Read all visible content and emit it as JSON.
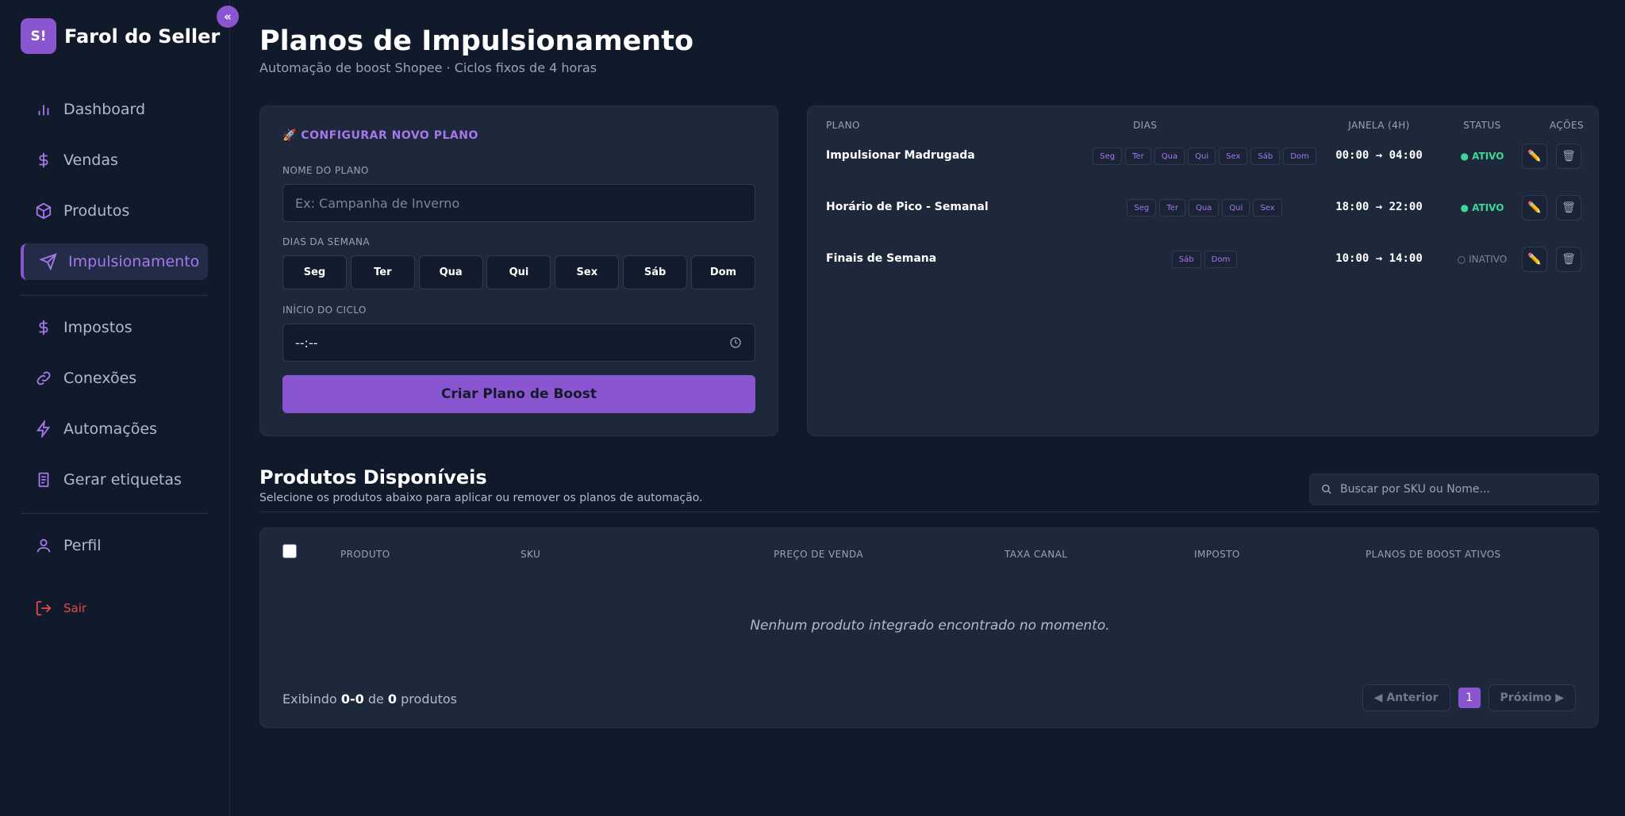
{
  "brand": {
    "logo": "S!",
    "name": "Farol do Seller"
  },
  "collapse_label": "«",
  "nav": {
    "items": [
      {
        "label": "Dashboard",
        "icon": "bar-chart-icon"
      },
      {
        "label": "Vendas",
        "icon": "dollar-icon"
      },
      {
        "label": "Produtos",
        "icon": "box-icon"
      },
      {
        "label": "Impulsionamento",
        "icon": "send-icon"
      },
      {
        "label": "Impostos",
        "icon": "dollar-icon"
      },
      {
        "label": "Conexões",
        "icon": "link-icon"
      },
      {
        "label": "Automações",
        "icon": "bolt-icon"
      },
      {
        "label": "Gerar etiquetas",
        "icon": "document-icon"
      },
      {
        "label": "Perfil",
        "icon": "user-icon"
      }
    ],
    "logout": "Sair"
  },
  "page": {
    "title": "Planos de Impulsionamento",
    "subtitle": "Automação de boost Shopee · Ciclos fixos de 4 horas"
  },
  "form": {
    "title": "🚀 CONFIGURAR NOVO PLANO",
    "name_label": "NOME DO PLANO",
    "name_placeholder": "Ex: Campanha de Inverno",
    "days_label": "DIAS DA SEMANA",
    "days": [
      "Seg",
      "Ter",
      "Qua",
      "Qui",
      "Sex",
      "Sáb",
      "Dom"
    ],
    "cycle_label": "INÍCIO DO CICLO",
    "cycle_value": "--:--",
    "submit": "Criar Plano de Boost"
  },
  "plans": {
    "headers": {
      "plan": "PLANO",
      "days": "DIAS",
      "window": "JANELA (4H)",
      "status": "STATUS",
      "actions": "AÇÕES"
    },
    "rows": [
      {
        "name": "Impulsionar Madrugada",
        "days": [
          "Seg",
          "Ter",
          "Qua",
          "Qui",
          "Sex",
          "Sáb",
          "Dom"
        ],
        "window": "00:00 → 04:00",
        "status": "● ATIVO",
        "active": true
      },
      {
        "name": "Horário de Pico - Semanal",
        "days": [
          "Seg",
          "Ter",
          "Qua",
          "Qui",
          "Sex"
        ],
        "window": "18:00 → 22:00",
        "status": "● ATIVO",
        "active": true
      },
      {
        "name": "Finais de Semana",
        "days": [
          "Sáb",
          "Dom"
        ],
        "window": "10:00 → 14:00",
        "status": "○ INATIVO",
        "active": false
      }
    ],
    "edit_icon": "✏️",
    "delete_icon": "🗑"
  },
  "products": {
    "title": "Produtos Disponíveis",
    "subtitle": "Selecione os produtos abaixo para aplicar ou remover os planos de automação.",
    "search_placeholder": "Buscar por SKU ou Nome...",
    "headers": [
      "PRODUTO",
      "SKU",
      "PREÇO DE VENDA",
      "TAXA CANAL",
      "IMPOSTO",
      "PLANOS DE BOOST ATIVOS"
    ],
    "empty": "Nenhum produto integrado encontrado no momento.",
    "summary": {
      "prefix": "Exibindo",
      "range": "0-0",
      "of": "de",
      "total": "0",
      "suffix": "produtos"
    },
    "pagination": {
      "prev": "◀ Anterior",
      "page": "1",
      "next": "Próximo ▶"
    }
  },
  "colors": {
    "accent": "#8a55d1",
    "active": "#3ed598",
    "danger": "#e5484d",
    "bg": "#111a2b",
    "card": "#1d283b"
  }
}
